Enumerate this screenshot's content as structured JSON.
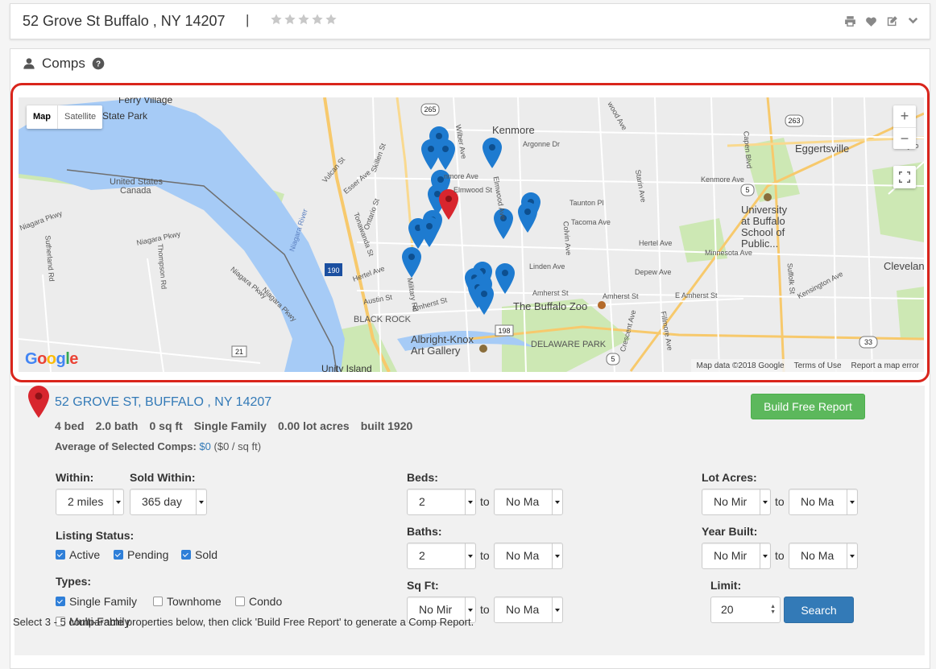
{
  "header": {
    "title": "52 Grove St Buffalo , NY 14207",
    "separator": "|",
    "star_count": 5,
    "star_color": "#c8c8c8",
    "icons": [
      "print-icon",
      "heart-icon",
      "edit-icon",
      "chevron-down-icon"
    ]
  },
  "comps": {
    "title": "Comps",
    "map": {
      "type_buttons": [
        "Map",
        "Satellite"
      ],
      "active_type": "Map",
      "zoom_in": "+",
      "zoom_out": "−",
      "google": "Google",
      "attribution": [
        "Map data ©2018 Google",
        "Terms of Use",
        "Report a map error"
      ],
      "labels": {
        "kenmore": "Kenmore",
        "eggertsville": "Eggertsville",
        "university": "University\nat Buffalo\nSchool of\nPublic...",
        "buffalo_zoo": "The Buffalo Zoo",
        "albright": "Albright-Knox\nArt Gallery",
        "delaware_park": "DELAWARE PARK",
        "black_rock": "BLACK ROCK",
        "cleveland": "Clevelan",
        "unity_island": "Unity Island",
        "united_states": "United States",
        "canada": "Canada",
        "niagara_river": "Niagara River",
        "ferry_village": "Ferry Village",
        "state_park": "State Park",
        "niagara_pkwy_1": "Niagara Pkwy",
        "niagara_pkwy_2": "Niagara Pkwy",
        "niagara_pkwy_3": "Niagara Pkwy",
        "niagara_pkwy_4": "Niagara Pkwy",
        "sutherland_rd": "Sutherland Rd",
        "thompson_rd": "Thompson Rd",
        "vulcan_st": "Vulcan St",
        "esser_ave": "Esser Ave",
        "skillen_st": "Skillen St",
        "ontario_st": "Ontario St",
        "tonawanda_st": "Tonawanda St",
        "hertel_ave_w": "Hertel Ave",
        "hertel_ave_e": "Hertel Ave",
        "austin_st": "Austin St",
        "amherst_st_w": "Amherst St",
        "amherst_st_c": "Amherst St",
        "amherst_st_e": "Amherst St",
        "e_amherst_st": "E Amherst St",
        "military_rd": "Military Rd",
        "elmwood_ave": "Elmwood Ave",
        "wilber_ave": "Wilber Ave",
        "kenmore_ave_w": "nmore Ave",
        "kenmore_ave_e": "Kenmore Ave",
        "elmwood_st": "Elmwood St",
        "argonne_dr": "Argonne Dr",
        "taunton_pl": "Taunton Pl",
        "tacoma_ave": "Tacoma Ave",
        "colvin_ave": "Colvin Ave",
        "linden_ave": "Linden Ave",
        "depew_ave": "Depew Ave",
        "minnesota_ave": "Minnesota Ave",
        "kensington_ave": "Kensington Ave",
        "starin_ave": "Starin Ave",
        "capen_blvd": "Capen Blvd",
        "suffolk_st": "Suffolk St",
        "crescent_ave": "Crescent Ave",
        "fillmore_ave": "Fillmore Ave",
        "wood_ave": "wood Ave",
        "nyco": "Nyco",
        "route_265": "265",
        "route_263": "263",
        "route_5a": "5",
        "route_5b": "5",
        "route_190": "190",
        "route_198": "198",
        "route_33": "33",
        "route_21": "21"
      }
    }
  },
  "subject": {
    "address": "52 GROVE ST, BUFFALO , NY 14207",
    "facts": [
      "4 bed",
      "2.0 bath",
      "0 sq ft",
      "Single Family",
      "0.00 lot acres",
      "built 1920"
    ],
    "avg_label": "Average of Selected Comps:",
    "avg_value": "$0",
    "avg_per_sqft": "($0 / sq ft)",
    "build_button": "Build Free Report"
  },
  "filters": {
    "within_label": "Within:",
    "within_value": "2 miles",
    "sold_within_label": "Sold Within:",
    "sold_within_value": "365 day",
    "listing_status_label": "Listing Status:",
    "status": [
      {
        "label": "Active",
        "checked": true
      },
      {
        "label": "Pending",
        "checked": true
      },
      {
        "label": "Sold",
        "checked": true
      }
    ],
    "types_label": "Types:",
    "types": [
      {
        "label": "Single Family",
        "checked": true
      },
      {
        "label": "Townhome",
        "checked": false
      },
      {
        "label": "Condo",
        "checked": false
      },
      {
        "label": "Multi-Family",
        "checked": false
      }
    ],
    "beds_label": "Beds:",
    "beds_min": "2",
    "beds_max": "No Ma",
    "baths_label": "Baths:",
    "baths_min": "2",
    "baths_max": "No Ma",
    "sqft_label": "Sq Ft:",
    "sqft_min": "No Mir",
    "sqft_max": "No Ma",
    "to": "to",
    "lot_label": "Lot Acres:",
    "lot_min": "No Mir",
    "lot_max": "No Ma",
    "year_label": "Year Built:",
    "year_min": "No Mir",
    "year_max": "No Ma",
    "limit_label": "Limit:",
    "limit_value": "20",
    "search_button": "Search"
  },
  "footer": {
    "text": "Select 3 - 5 comparable properties below, then click 'Build Free Report' to generate a Comp Report."
  },
  "colors": {
    "accent_blue": "#337ab7",
    "green": "#5cb85c",
    "highlight_red": "#d9251c",
    "pin_blue": "#1e7bd0",
    "pin_red": "#d8262e"
  }
}
